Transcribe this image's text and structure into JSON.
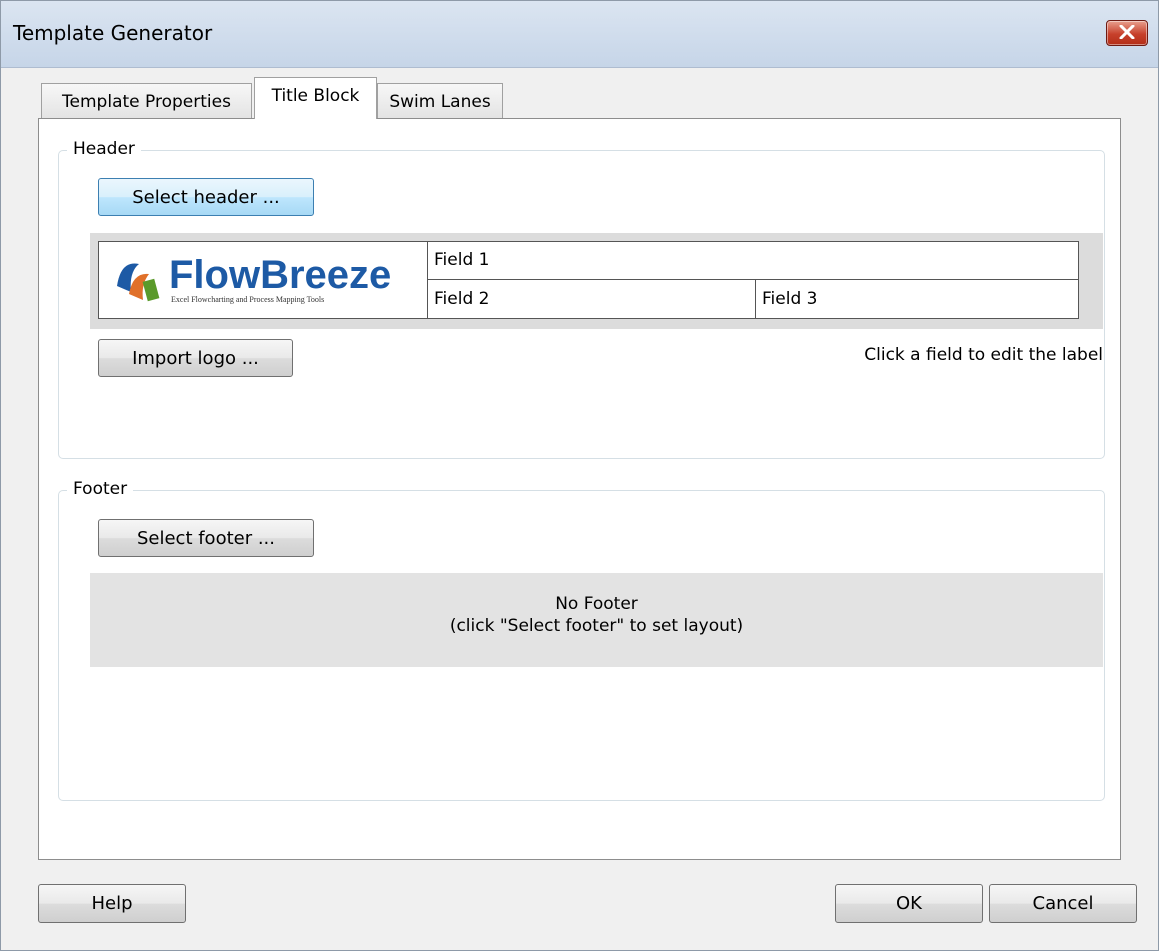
{
  "window": {
    "title": "Template Generator"
  },
  "tabs": [
    {
      "label": "Template Properties"
    },
    {
      "label": "Title Block"
    },
    {
      "label": "Swim Lanes"
    }
  ],
  "header_group": {
    "legend": "Header",
    "select_button": "Select header ...",
    "fields": {
      "field1": "Field 1",
      "field2": "Field 2",
      "field3": "Field 3"
    },
    "logo": {
      "brand": "FlowBreeze",
      "tagline": "Excel Flowcharting and Process Mapping Tools"
    },
    "import_button": "Import logo ...",
    "hint": "Click a field to edit the label"
  },
  "footer_group": {
    "legend": "Footer",
    "select_button": "Select footer ...",
    "empty_title": "No Footer",
    "empty_hint": "(click \"Select footer\" to set layout)"
  },
  "buttons": {
    "help": "Help",
    "ok": "OK",
    "cancel": "Cancel"
  },
  "colors": {
    "titlebar": "#c6d5e8",
    "close": "#c7402b",
    "focus_button": "#bee6fd",
    "logo_blue": "#1d5aa5",
    "logo_orange": "#e0702a",
    "logo_green": "#5a9a2a"
  }
}
